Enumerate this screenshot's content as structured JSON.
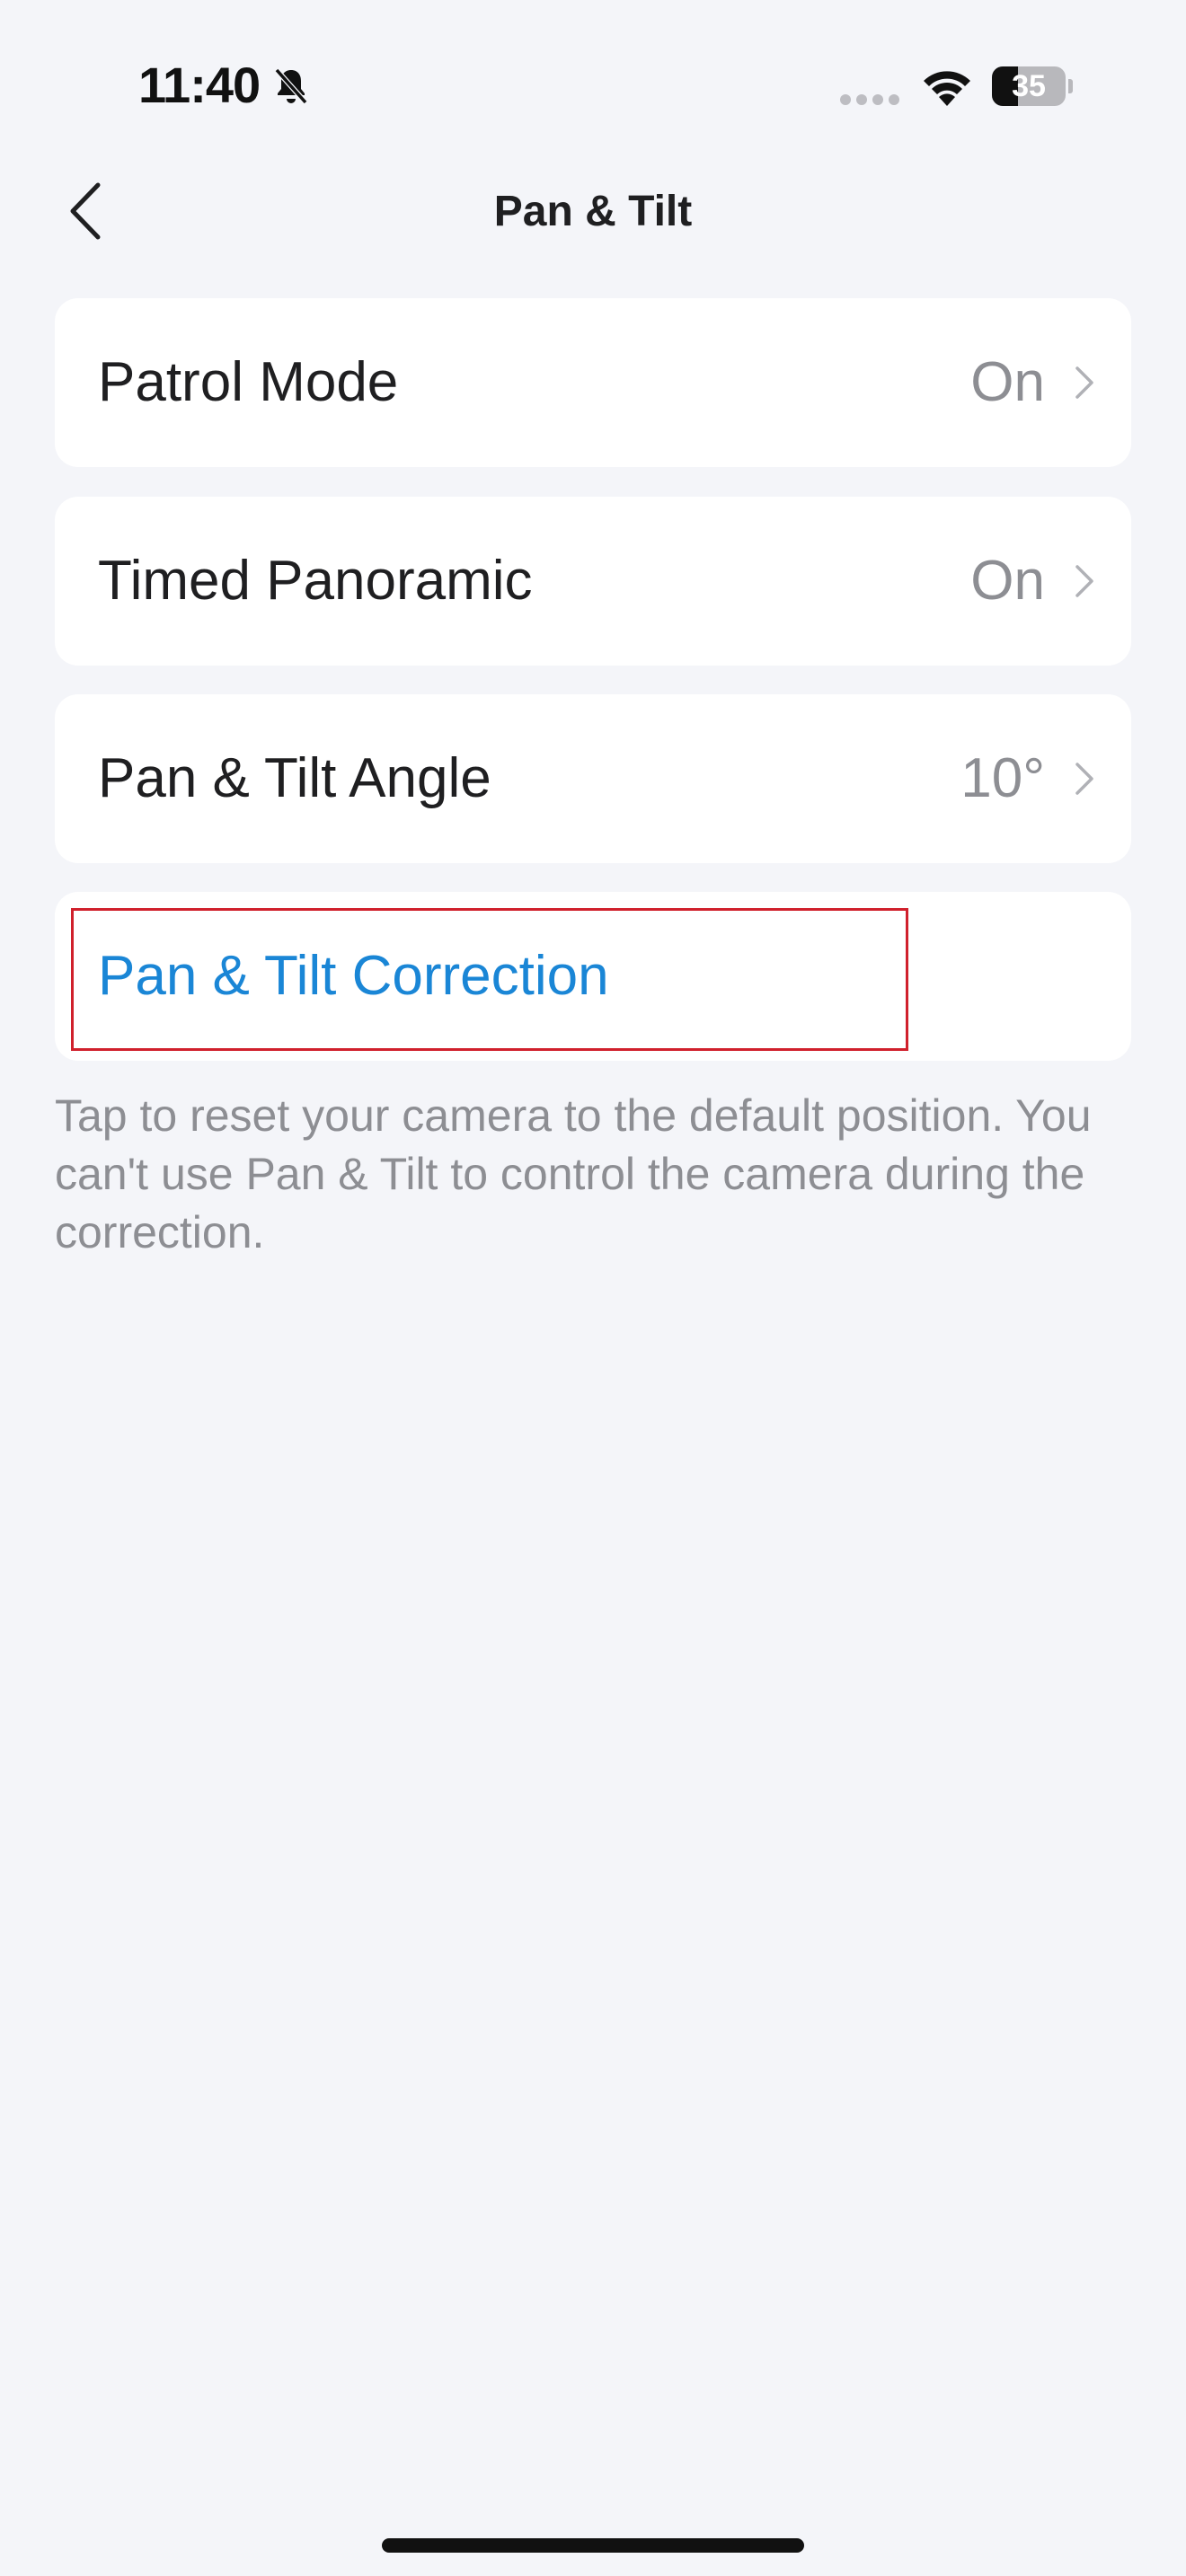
{
  "status_bar": {
    "time": "11:40",
    "battery_level": "35",
    "icons": [
      "bell-slash-icon",
      "cellular-signal-icon",
      "wifi-icon",
      "battery-icon"
    ]
  },
  "nav": {
    "title": "Pan & Tilt",
    "back_icon": "chevron-left-icon"
  },
  "settings": [
    {
      "label": "Patrol Mode",
      "value": "On"
    },
    {
      "label": "Timed Panoramic",
      "value": "On"
    },
    {
      "label": "Pan & Tilt Angle",
      "value": "10°"
    }
  ],
  "correction": {
    "label": "Pan & Tilt Correction",
    "helper_text": "Tap to reset your camera to the default position. You can't use Pan & Tilt to control the camera during the correction."
  },
  "colors": {
    "background": "#f4f5f9",
    "card": "#ffffff",
    "link": "#1a86d6",
    "secondary_text": "#8d8e93",
    "highlight": "#d0202c"
  }
}
